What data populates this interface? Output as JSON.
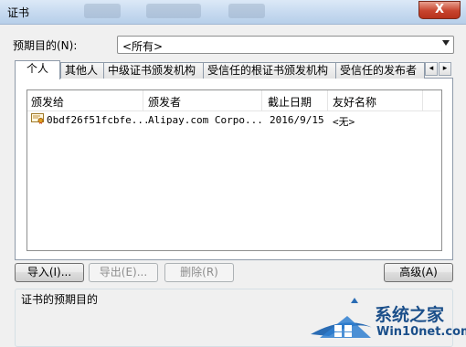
{
  "window": {
    "title": "证书",
    "close_label": "X"
  },
  "purpose": {
    "label": "预期目的(N):",
    "selected": "<所有>"
  },
  "tabs": [
    {
      "label": "个人",
      "active": true
    },
    {
      "label": "其他人"
    },
    {
      "label": "中级证书颁发机构"
    },
    {
      "label": "受信任的根证书颁发机构"
    },
    {
      "label": "受信任的发布者"
    }
  ],
  "tab_scroll": {
    "left": "◂",
    "right": "▸"
  },
  "list": {
    "columns": [
      "颁发给",
      "颁发者",
      "截止日期",
      "友好名称"
    ],
    "rows": [
      {
        "issued_to": "0bdf26f51fcbfe...",
        "issued_by": "Alipay.com Corpo...",
        "expires": "2016/9/15",
        "friendly_name": "<无>"
      }
    ]
  },
  "buttons": {
    "import": "导入(I)...",
    "export": "导出(E)...",
    "remove": "删除(R)",
    "advanced": "高级(A)"
  },
  "group": {
    "label": "证书的预期目的"
  },
  "watermark": {
    "line1": "系统之家",
    "line2": "Win10net.com"
  },
  "colors": {
    "accent": "#1b4f8a",
    "close": "#c7432d"
  }
}
